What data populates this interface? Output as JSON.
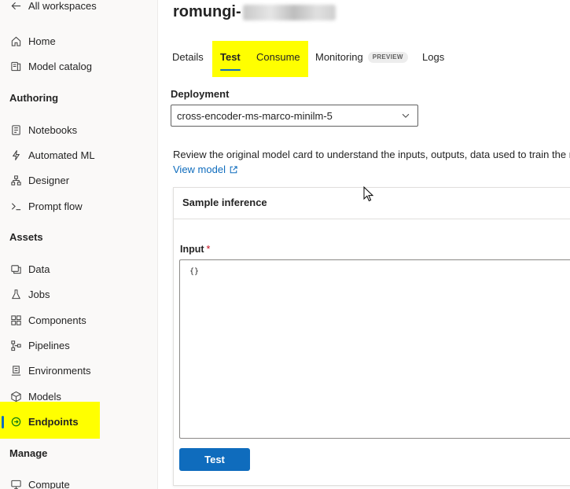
{
  "sidebar": {
    "back_label": "All workspaces",
    "items_top": [
      {
        "label": "Home",
        "icon": "home-icon"
      },
      {
        "label": "Model catalog",
        "icon": "catalog-icon"
      }
    ],
    "sections": [
      {
        "title": "Authoring",
        "items": [
          {
            "label": "Notebooks",
            "icon": "notebook-icon"
          },
          {
            "label": "Automated ML",
            "icon": "automl-icon"
          },
          {
            "label": "Designer",
            "icon": "designer-icon"
          },
          {
            "label": "Prompt flow",
            "icon": "prompt-icon"
          }
        ]
      },
      {
        "title": "Assets",
        "items": [
          {
            "label": "Data",
            "icon": "data-icon"
          },
          {
            "label": "Jobs",
            "icon": "jobs-icon"
          },
          {
            "label": "Components",
            "icon": "components-icon"
          },
          {
            "label": "Pipelines",
            "icon": "pipelines-icon"
          },
          {
            "label": "Environments",
            "icon": "environments-icon"
          },
          {
            "label": "Models",
            "icon": "models-icon"
          },
          {
            "label": "Endpoints",
            "icon": "endpoints-icon",
            "selected": true
          }
        ]
      },
      {
        "title": "Manage",
        "items": [
          {
            "label": "Compute",
            "icon": "compute-icon"
          }
        ]
      }
    ]
  },
  "header": {
    "title_prefix": "romungi-"
  },
  "tabs": [
    {
      "label": "Details"
    },
    {
      "label": "Test",
      "active": true
    },
    {
      "label": "Consume"
    },
    {
      "label": "Monitoring",
      "badge": "PREVIEW"
    },
    {
      "label": "Logs"
    }
  ],
  "deployment": {
    "label": "Deployment",
    "value": "cross-encoder-ms-marco-minilm-5"
  },
  "description": {
    "text": "Review the original model card to understand the inputs, outputs, data used to train the mo",
    "link": "View model"
  },
  "sample": {
    "title": "Sample inference",
    "input_label": "Input",
    "required_mark": "*",
    "input_value": "{}",
    "button": "Test"
  },
  "colors": {
    "accent": "#0f6cbd",
    "highlight": "#ffff00",
    "required": "#c50f1f"
  }
}
